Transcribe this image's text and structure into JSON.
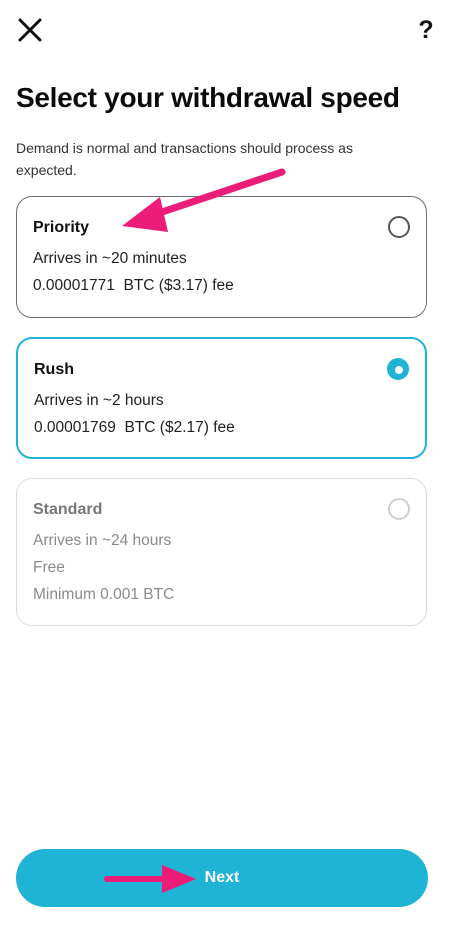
{
  "header": {
    "close_icon": "close-icon",
    "help_label": "?"
  },
  "title": "Select your withdrawal speed",
  "subtitle": "Demand is normal and transactions should process as expected.",
  "options": [
    {
      "name": "Priority",
      "lines": [
        "Arrives in ~20 minutes",
        "0.00001771  BTC ($3.17) fee"
      ],
      "selected": false,
      "enabled": true
    },
    {
      "name": "Rush",
      "lines": [
        "Arrives in ~2 hours",
        "0.00001769  BTC ($2.17) fee"
      ],
      "selected": true,
      "enabled": true
    },
    {
      "name": "Standard",
      "lines": [
        "Arrives in ~24 hours",
        "Free",
        "Minimum 0.001 BTC"
      ],
      "selected": false,
      "enabled": false
    }
  ],
  "next_label": "Next",
  "colors": {
    "accent": "#1fb3d6",
    "annotation_arrow": "#ec1c79",
    "selected_border": "#1fb3d6",
    "priority_border": "#6e6e6e",
    "disabled_text": "#8a8a8a"
  }
}
